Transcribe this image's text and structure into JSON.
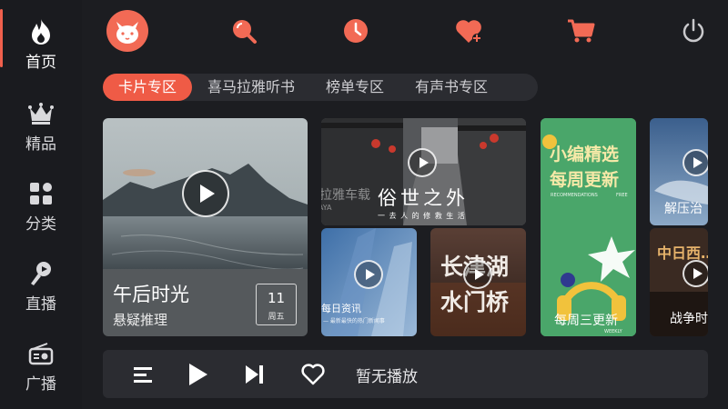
{
  "sidebar": {
    "items": [
      {
        "label": "首页",
        "icon": "flame-icon",
        "active": true
      },
      {
        "label": "精品",
        "icon": "crown-icon"
      },
      {
        "label": "分类",
        "icon": "grid-icon"
      },
      {
        "label": "直播",
        "icon": "microphone-icon"
      },
      {
        "label": "广播",
        "icon": "radio-icon"
      }
    ],
    "accent": "#f0604d"
  },
  "topbar": {
    "icons": [
      "cat-avatar-icon",
      "search-icon",
      "history-clock-icon",
      "favorite-heart-icon",
      "cart-icon",
      "power-icon"
    ]
  },
  "tabs": [
    {
      "label": "卡片专区",
      "active": true
    },
    {
      "label": "喜马拉雅听书"
    },
    {
      "label": "榜单专区"
    },
    {
      "label": "有声书专区"
    }
  ],
  "cards": {
    "featured": {
      "title": "午后时光",
      "subtitle": "悬疑推理",
      "date_day": "11",
      "date_weekday": "周五"
    },
    "street": {
      "title": "俗世之外",
      "tagline": "一 去 人 的 修 救 生 活",
      "watermark": "喜马拉雅车载",
      "watermark_en": "XIMALAYA"
    },
    "news": {
      "title": "每日资讯",
      "subtitle": "— 最新最快的热门新闻事"
    },
    "movie": {
      "title_line1": "长津湖",
      "title_line2": "水门桥"
    },
    "editor": {
      "title_line1": "小编精选",
      "title_line2": "每周更新",
      "en": "RECOMMENDATIONS",
      "en2": "FREE",
      "badge": "WEEKLY",
      "caption": "每周三更新"
    },
    "relax": {
      "caption": "解压治"
    },
    "war": {
      "title_hint": "中日西…",
      "caption": "战争时"
    }
  },
  "player": {
    "status": "暂无播放",
    "icons": [
      "playlist-icon",
      "play-icon",
      "next-track-icon",
      "heart-outline-icon"
    ]
  }
}
